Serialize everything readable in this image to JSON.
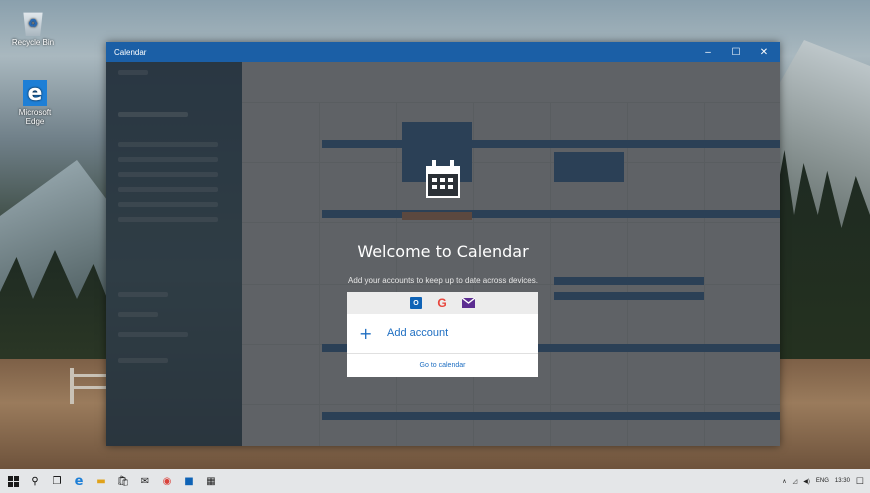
{
  "desktop": {
    "icons": [
      {
        "label": "Recycle Bin",
        "icon": "recycle-bin-icon"
      },
      {
        "label": "Microsoft Edge",
        "icon": "edge-icon"
      }
    ]
  },
  "window": {
    "title": "Calendar",
    "controls": {
      "minimize": "–",
      "maximize": "☐",
      "close": "✕"
    }
  },
  "welcome": {
    "title": "Welcome to Calendar",
    "subtitle": "Add your accounts to keep up to date across devices.",
    "providers": [
      "outlook-icon",
      "google-icon",
      "mail-icon"
    ],
    "google_glyph": "G",
    "outlook_glyph": "O",
    "add_account": "Add account",
    "add_glyph": "+",
    "go_to_calendar": "Go to calendar"
  },
  "taskbar": {
    "icons": [
      "start",
      "search",
      "task-view",
      "edge",
      "file-explorer",
      "store",
      "mail",
      "chrome",
      "outlook",
      "calendar"
    ],
    "tray": {
      "language": "ENG",
      "time": "13:30"
    }
  },
  "colors": {
    "accent": "#1b5fa6",
    "link": "#1e6ec2",
    "event": "#2f6fb4"
  }
}
